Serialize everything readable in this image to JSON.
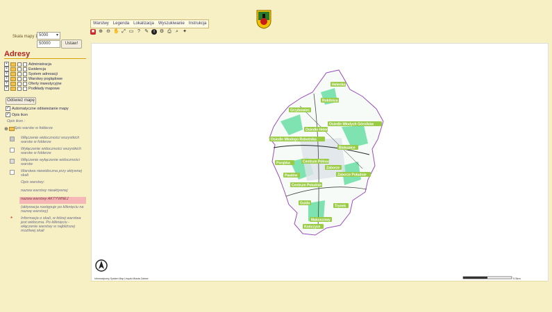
{
  "menu": [
    "Warstwy",
    "Legenda",
    "Lokalizacja",
    "Wyszukiwanie",
    "Instrukcja"
  ],
  "tools": [
    "home-icon",
    "zoom-in-icon",
    "zoom-out-icon",
    "pan-icon",
    "zoom-extent-icon",
    "select-icon",
    "query-icon",
    "measure-icon",
    "info-icon",
    "tool-icon",
    "print-icon",
    "search-icon",
    "settings-icon"
  ],
  "scale": {
    "label": "Skala mapy 1:",
    "selected": "5000",
    "input": "50000",
    "button": "Ustaw!"
  },
  "panel": {
    "title": "Adresy",
    "layers": [
      "Administracja",
      "Ewidencja",
      "System adresacji",
      "Warstwy poglądowe",
      "Oferty inwestycyjne",
      "Podkłady mapowe"
    ],
    "refresh_button": "Odśwież mapę",
    "auto_refresh": "Automatyczne odświeżanie mapy",
    "labels_desc": "Opis ikon",
    "legend_title": "Opis ikon :",
    "legend": [
      "Spis warstw w folderze",
      "Włączenie widoczności wszystkich warstw w folderze",
      "Wyłączenie widoczności wszystkich warstw w folderze",
      "Włączenie wyłączenie widoczności warstw",
      "Warstwa niewidoczna przy aktywnej skali",
      "Opis warstwy:",
      "nazwa warstwy nieaktywnej",
      "nazwa warstwy AKTYWNEJ",
      "(aktywacja następuje po kliknięciu na nazwę warstwy)",
      "Informacja o skali, w której warstwa jest widoczna. Po kliknięciu - włączenie warstwy w najbliższej możliwej skali"
    ]
  },
  "map": {
    "places": [
      "Helenka",
      "Rokitnica",
      "Grzybowiec",
      "Osiedle Młodych Górników",
      "Osiedle Helenki",
      "Osiedle Młodego Robotnika",
      "Biskupice",
      "Porąbka",
      "Centrum Północ",
      "Zaborze",
      "Pawłów",
      "Centrum Południe",
      "Zaborze Południe",
      "Guido",
      "Trynek",
      "Makoszowy",
      "Kończyce"
    ],
    "attribution": "Informatyczny System Map Urzędu Miasta Zabrze",
    "scalebar_label": "0.5km"
  }
}
